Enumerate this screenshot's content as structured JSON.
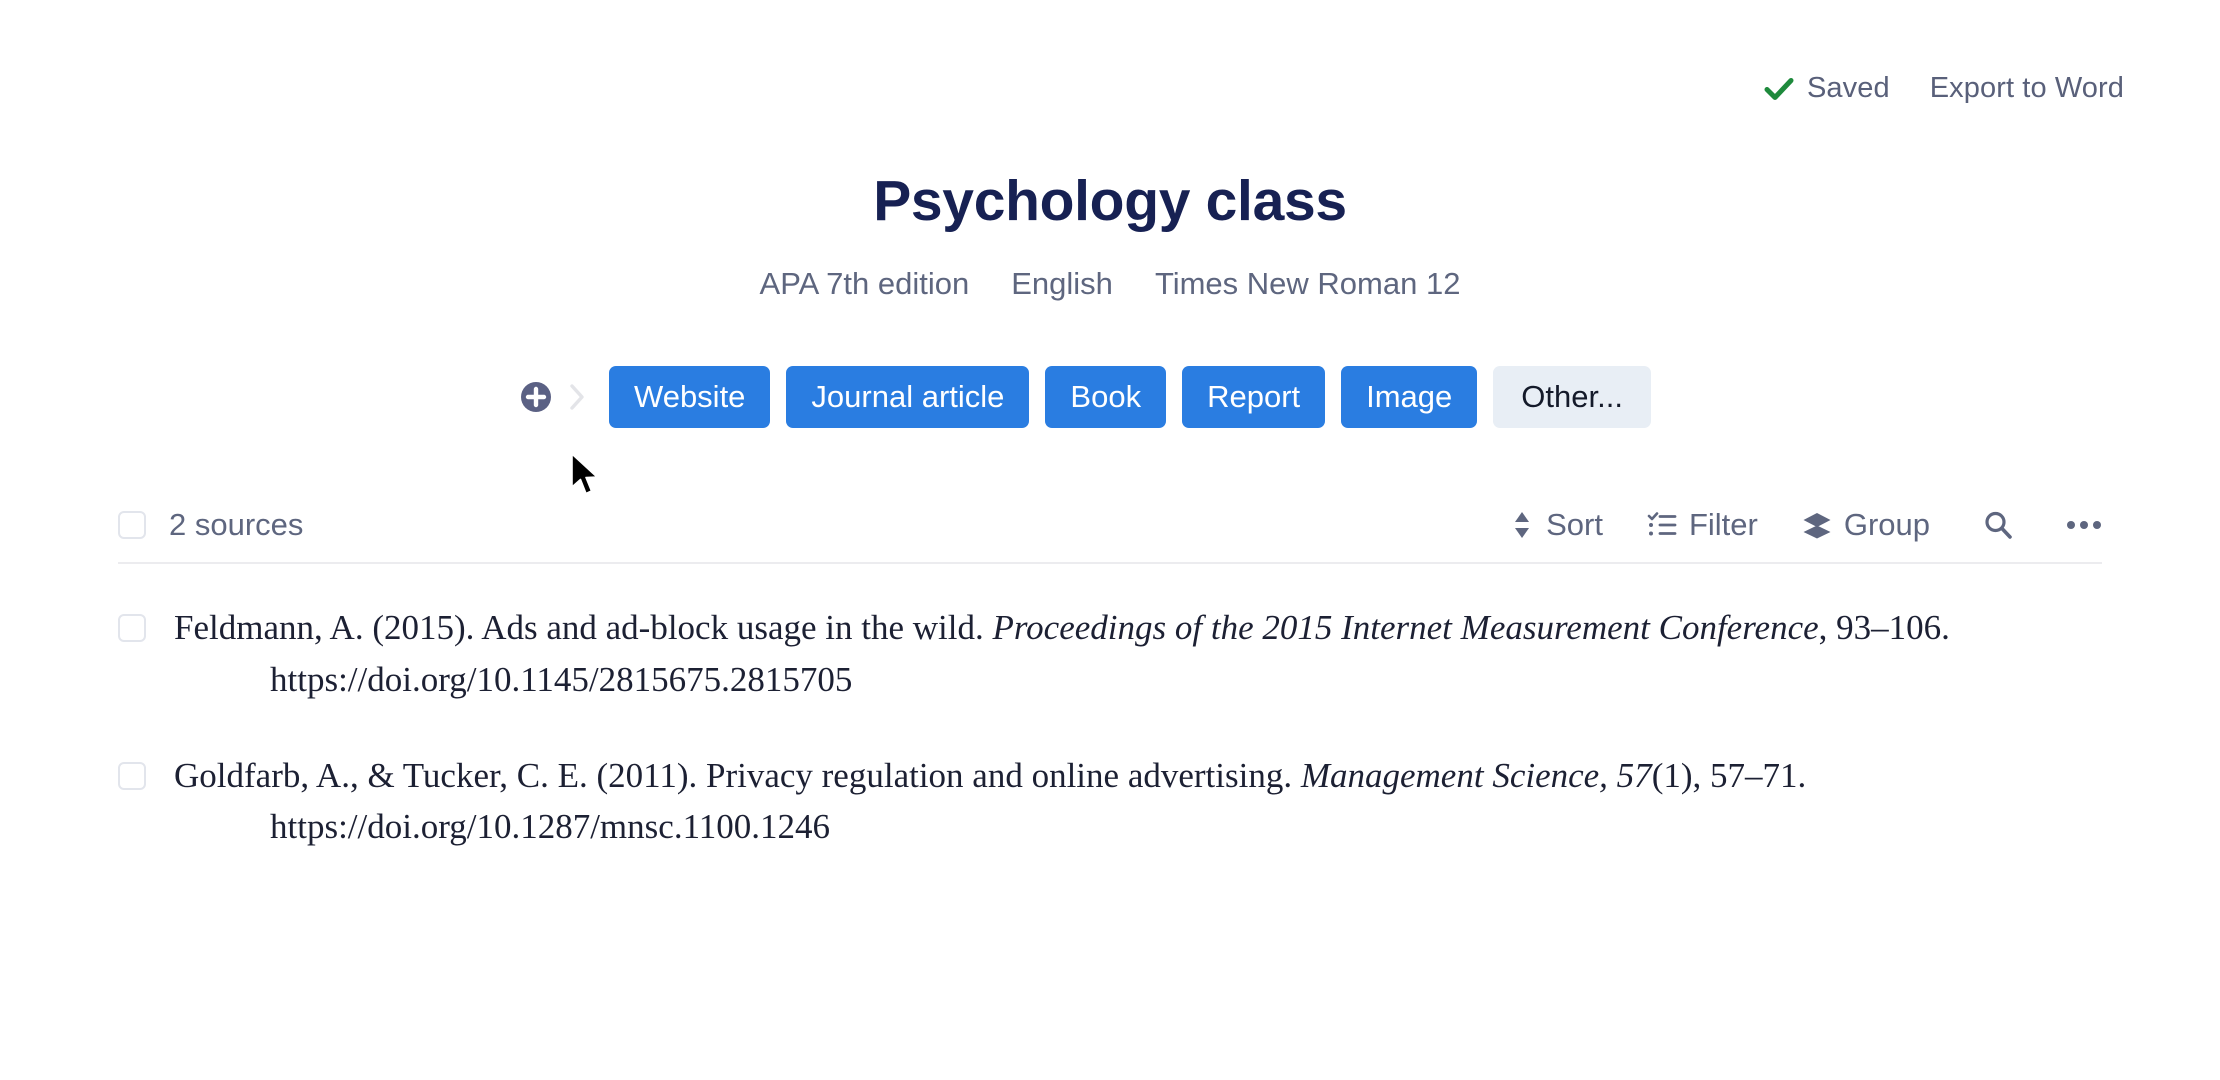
{
  "topbar": {
    "saved_label": "Saved",
    "saved_icon": "check-icon",
    "saved_color": "#1e8a3c",
    "export_label": "Export to Word"
  },
  "header": {
    "title": "Psychology class",
    "title_color": "#172153",
    "meta": {
      "style": "APA 7th edition",
      "language": "English",
      "font": "Times New Roman 12"
    }
  },
  "source_types": {
    "add_icon": "plus-circle-icon",
    "chevron_icon": "chevron-right-icon",
    "accent_color": "#2a7de1",
    "buttons": [
      {
        "label": "Website",
        "variant": "primary"
      },
      {
        "label": "Journal article",
        "variant": "primary"
      },
      {
        "label": "Book",
        "variant": "primary"
      },
      {
        "label": "Report",
        "variant": "primary"
      },
      {
        "label": "Image",
        "variant": "primary"
      },
      {
        "label": "Other...",
        "variant": "muted"
      }
    ]
  },
  "toolbar": {
    "select_all_checkbox": "",
    "sources_count_label": "2 sources",
    "actions": [
      {
        "label": "Sort",
        "icon": "sort-arrows-icon"
      },
      {
        "label": "Filter",
        "icon": "filter-list-icon"
      },
      {
        "label": "Group",
        "icon": "layers-icon"
      }
    ],
    "search_icon": "search-icon",
    "more_icon": "more-horizontal-icon"
  },
  "citations": [
    {
      "authors_year_title": "Feldmann, A. (2015). Ads and ad-block usage in the wild. ",
      "container_italic": "Proceedings of the 2015 Internet Measurement Conference",
      "locator": ", 93–106.",
      "doi": "https://doi.org/10.1145/2815675.2815705"
    },
    {
      "authors_year_title": "Goldfarb, A., & Tucker, C. E. (2011). Privacy regulation and online advertising. ",
      "container_italic": "Management Science, 57",
      "locator": "(1), 57–71.",
      "doi": "https://doi.org/10.1287/mnsc.1100.1246"
    }
  ]
}
